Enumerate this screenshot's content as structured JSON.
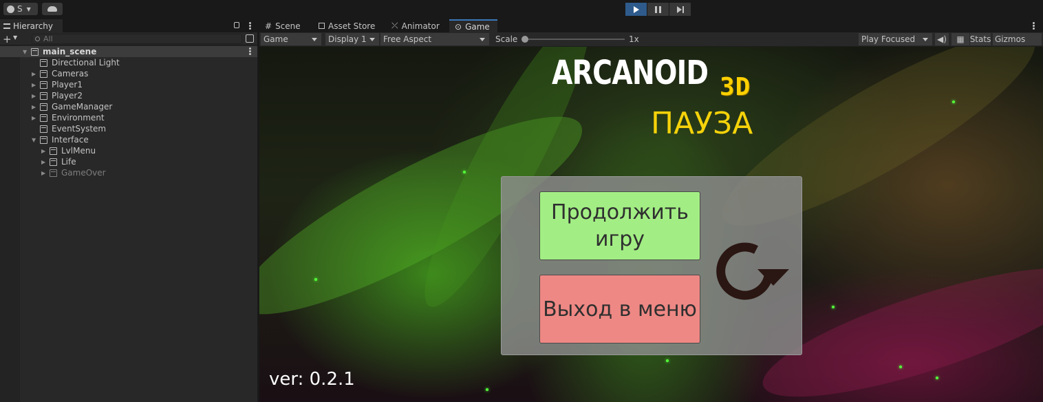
{
  "toolbar": {
    "account_label": "S",
    "play_active_color": "#2e5b8c"
  },
  "hierarchy": {
    "tab_label": "Hierarchy",
    "search_placeholder": "All",
    "scene": "main_scene",
    "items": [
      {
        "label": "Directional Light",
        "depth": 1,
        "expandable": false,
        "dim": false
      },
      {
        "label": "Cameras",
        "depth": 1,
        "expandable": true,
        "dim": false
      },
      {
        "label": "Player1",
        "depth": 1,
        "expandable": true,
        "dim": false
      },
      {
        "label": "Player2",
        "depth": 1,
        "expandable": true,
        "dim": false
      },
      {
        "label": "GameManager",
        "depth": 1,
        "expandable": true,
        "dim": false
      },
      {
        "label": "Environment",
        "depth": 1,
        "expandable": true,
        "dim": false
      },
      {
        "label": "EventSystem",
        "depth": 1,
        "expandable": false,
        "dim": false
      },
      {
        "label": "Interface",
        "depth": 1,
        "expandable": true,
        "expanded": true,
        "dim": false
      },
      {
        "label": "LvlMenu",
        "depth": 2,
        "expandable": true,
        "dim": false
      },
      {
        "label": "Life",
        "depth": 2,
        "expandable": true,
        "dim": false
      },
      {
        "label": "GameOver",
        "depth": 2,
        "expandable": true,
        "dim": true
      }
    ]
  },
  "tabs": [
    {
      "label": "Scene",
      "icon": "grid-icon"
    },
    {
      "label": "Asset Store",
      "icon": "bag-icon"
    },
    {
      "label": "Animator",
      "icon": "animator-icon"
    },
    {
      "label": "Game",
      "icon": "gamepad-icon",
      "active": true
    }
  ],
  "game_bar": {
    "view_select": "Game",
    "display_select": "Display 1",
    "aspect_select": "Free Aspect",
    "scale_label": "Scale",
    "scale_value": "1x",
    "play_mode": "Play Focused",
    "stats_label": "Stats",
    "gizmos_label": "Gizmos"
  },
  "game": {
    "title": "ARCANOID",
    "subtitle": "3D",
    "pause_label": "ПАУЗА",
    "continue_line1": "Продолжить",
    "continue_line2": "игру",
    "exit_label": "Выход в меню",
    "version": "ver: 0.2.1",
    "colors": {
      "title": "#ffffff",
      "accent_yellow": "#f5d20a",
      "continue_bg": "#a2ee84",
      "exit_bg": "#ee8884"
    }
  }
}
